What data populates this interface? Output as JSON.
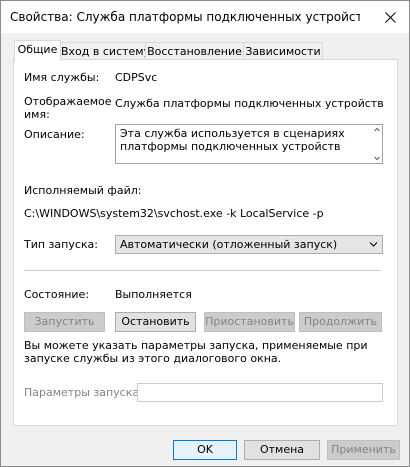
{
  "window": {
    "title": "Свойства: Служба платформы подключенных устройств (Лока..."
  },
  "tabs": [
    {
      "label": "Общие"
    },
    {
      "label": "Вход в систему"
    },
    {
      "label": "Восстановление"
    },
    {
      "label": "Зависимости"
    }
  ],
  "general": {
    "service_name_label": "Имя службы:",
    "service_name_value": "CDPSvc",
    "display_name_label_1": "Отображаемое",
    "display_name_label_2": "имя:",
    "display_name_value": "Служба платформы подключенных устройств",
    "description_label": "Описание:",
    "description_value": "Эта служба используется в сценариях платформы подключенных устройств",
    "exe_label": "Исполняемый файл:",
    "exe_value": "C:\\WINDOWS\\system32\\svchost.exe -k LocalService -p",
    "startup_type_label": "Тип запуска:",
    "startup_type_value": "Автоматически (отложенный запуск)",
    "status_label": "Состояние:",
    "status_value": "Выполняется",
    "start_button": "Запустить",
    "stop_button": "Остановить",
    "pause_button": "Приостановить",
    "resume_button": "Продолжить",
    "hint_text": "Вы можете указать параметры запуска, применяемые при запуске службы из этого диалогового окна.",
    "params_label": "Параметры запуска:",
    "params_value": ""
  },
  "footer": {
    "ok": "OK",
    "cancel": "Отмена",
    "apply": "Применить"
  },
  "icons": {
    "close": "close-icon",
    "dropdown": "chevron-down-icon"
  }
}
